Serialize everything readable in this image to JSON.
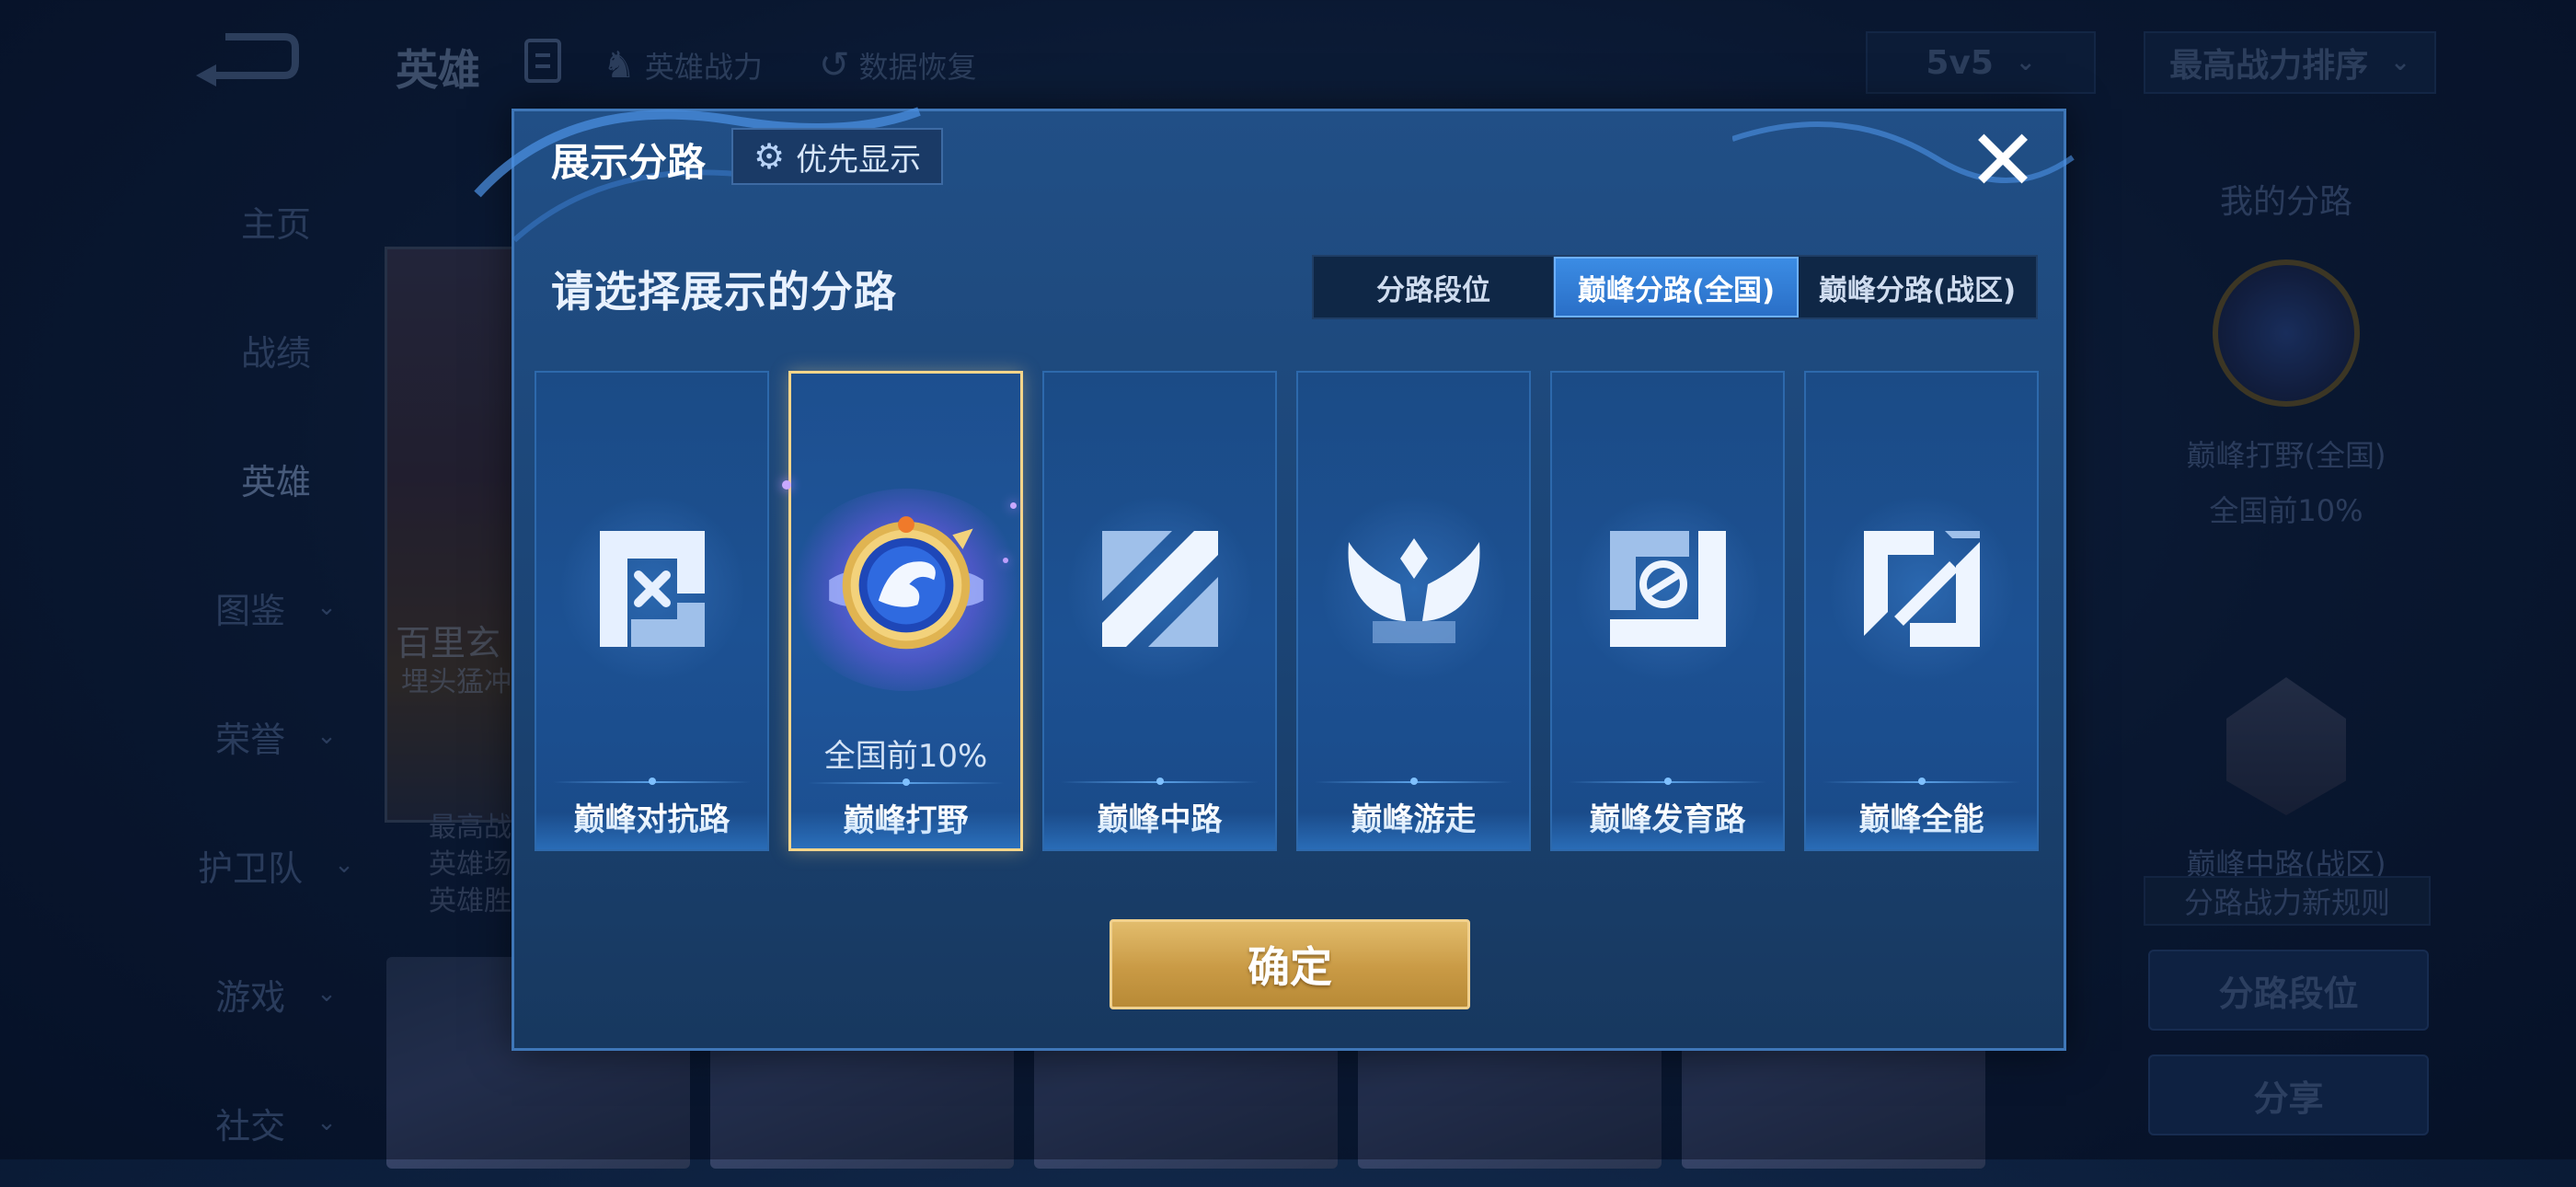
{
  "background": {
    "header": {
      "title": "英雄",
      "link_power": "英雄战力",
      "link_restore": "数据恢复",
      "mode_select": "5v5",
      "sort_select": "最高战力排序"
    },
    "sidenav": [
      {
        "label": "主页"
      },
      {
        "label": "战绩"
      },
      {
        "label": "英雄"
      },
      {
        "label": "图鉴"
      },
      {
        "label": "荣誉"
      },
      {
        "label": "护卫队"
      },
      {
        "label": "游戏"
      },
      {
        "label": "社交"
      }
    ],
    "hero": {
      "name": "百里玄",
      "subtitle": "埋头猛冲",
      "stats": [
        "最高战",
        "英雄场",
        "英雄胜"
      ]
    },
    "right_panel": {
      "title": "我的分路",
      "badge1_label": "巅峰打野(全国)",
      "badge1_rank": "全国前10%",
      "badge2_label": "巅峰中路(战区)",
      "rule_link": "分路战力新规则",
      "btn_lane_rank": "分路段位",
      "btn_share": "分享"
    }
  },
  "modal": {
    "title": "展示分路",
    "priority_button": "优先显示",
    "heading": "请选择展示的分路",
    "tabs": [
      {
        "label": "分路段位",
        "active": false
      },
      {
        "label": "巅峰分路(全国)",
        "active": true
      },
      {
        "label": "巅峰分路(战区)",
        "active": false
      }
    ],
    "cards": [
      {
        "label": "巅峰对抗路",
        "rank": "",
        "icon": "sword-lane-icon",
        "selected": false
      },
      {
        "label": "巅峰打野",
        "rank": "全国前10%",
        "icon": "jungle-dragon-badge-icon",
        "selected": true
      },
      {
        "label": "巅峰中路",
        "rank": "",
        "icon": "mid-lane-icon",
        "selected": false
      },
      {
        "label": "巅峰游走",
        "rank": "",
        "icon": "roam-wings-icon",
        "selected": false
      },
      {
        "label": "巅峰发育路",
        "rank": "",
        "icon": "farm-lane-icon",
        "selected": false
      },
      {
        "label": "巅峰全能",
        "rank": "",
        "icon": "all-round-icon",
        "selected": false
      }
    ],
    "confirm_button": "确定"
  },
  "colors": {
    "accent_blue": "#2a6fc7",
    "gold": "#c99a45",
    "selected_border": "#f5d58a"
  }
}
